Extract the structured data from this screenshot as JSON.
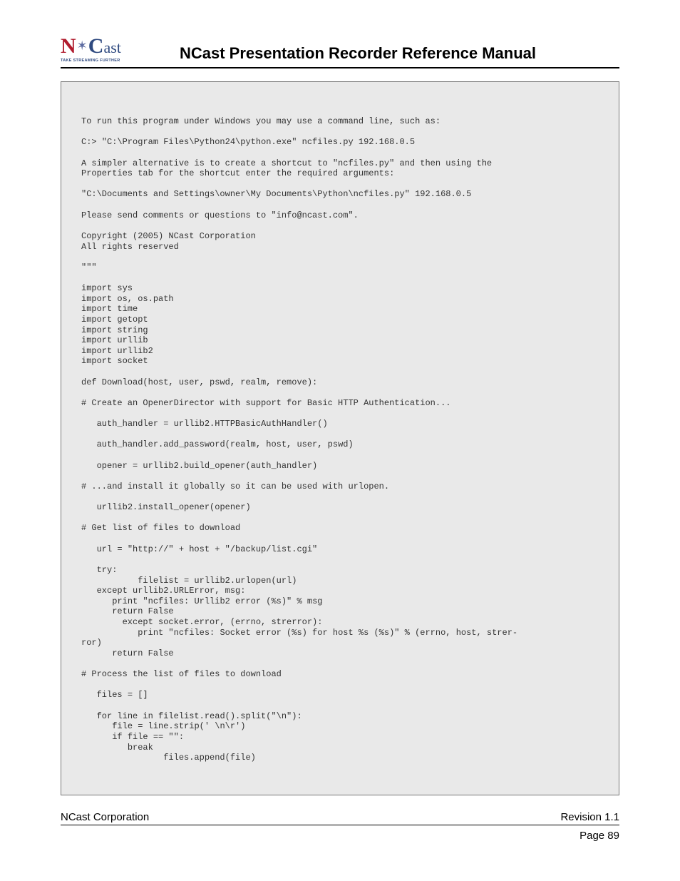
{
  "header": {
    "logo_n": "N",
    "logo_star": "✶",
    "logo_c": "C",
    "logo_ast": "ast",
    "logo_tag": "TAKE STREAMING FURTHER",
    "title": "NCast Presentation Recorder Reference Manual"
  },
  "code": "To run this program under Windows you may use a command line, such as:\n\nC:> \"C:\\Program Files\\Python24\\python.exe\" ncfiles.py 192.168.0.5\n\nA simpler alternative is to create a shortcut to \"ncfiles.py\" and then using the\nProperties tab for the shortcut enter the required arguments:\n\n\"C:\\Documents and Settings\\owner\\My Documents\\Python\\ncfiles.py\" 192.168.0.5\n\nPlease send comments or questions to \"info@ncast.com\".\n\nCopyright (2005) NCast Corporation\nAll rights reserved\n\n\"\"\"\n\nimport sys\nimport os, os.path\nimport time\nimport getopt\nimport string\nimport urllib\nimport urllib2\nimport socket\n\ndef Download(host, user, pswd, realm, remove):\n\n# Create an OpenerDirector with support for Basic HTTP Authentication...\n\n   auth_handler = urllib2.HTTPBasicAuthHandler()\n\n   auth_handler.add_password(realm, host, user, pswd)\n\n   opener = urllib2.build_opener(auth_handler)\n\n# ...and install it globally so it can be used with urlopen.\n\n   urllib2.install_opener(opener)\n\n# Get list of files to download\n\n   url = \"http://\" + host + \"/backup/list.cgi\"\n\n   try:\n           filelist = urllib2.urlopen(url)\n   except urllib2.URLError, msg:\n      print \"ncfiles: Urllib2 error (%s)\" % msg\n      return False\n        except socket.error, (errno, strerror):\n           print \"ncfiles: Socket error (%s) for host %s (%s)\" % (errno, host, strer-\nror)\n      return False\n\n# Process the list of files to download\n\n   files = []\n\n   for line in filelist.read().split(\"\\n\"):\n      file = line.strip(' \\n\\r')\n      if file == \"\":\n         break\n                files.append(file)",
  "footer": {
    "left": "NCast Corporation",
    "right": "Revision 1.1",
    "page": "Page 89"
  }
}
